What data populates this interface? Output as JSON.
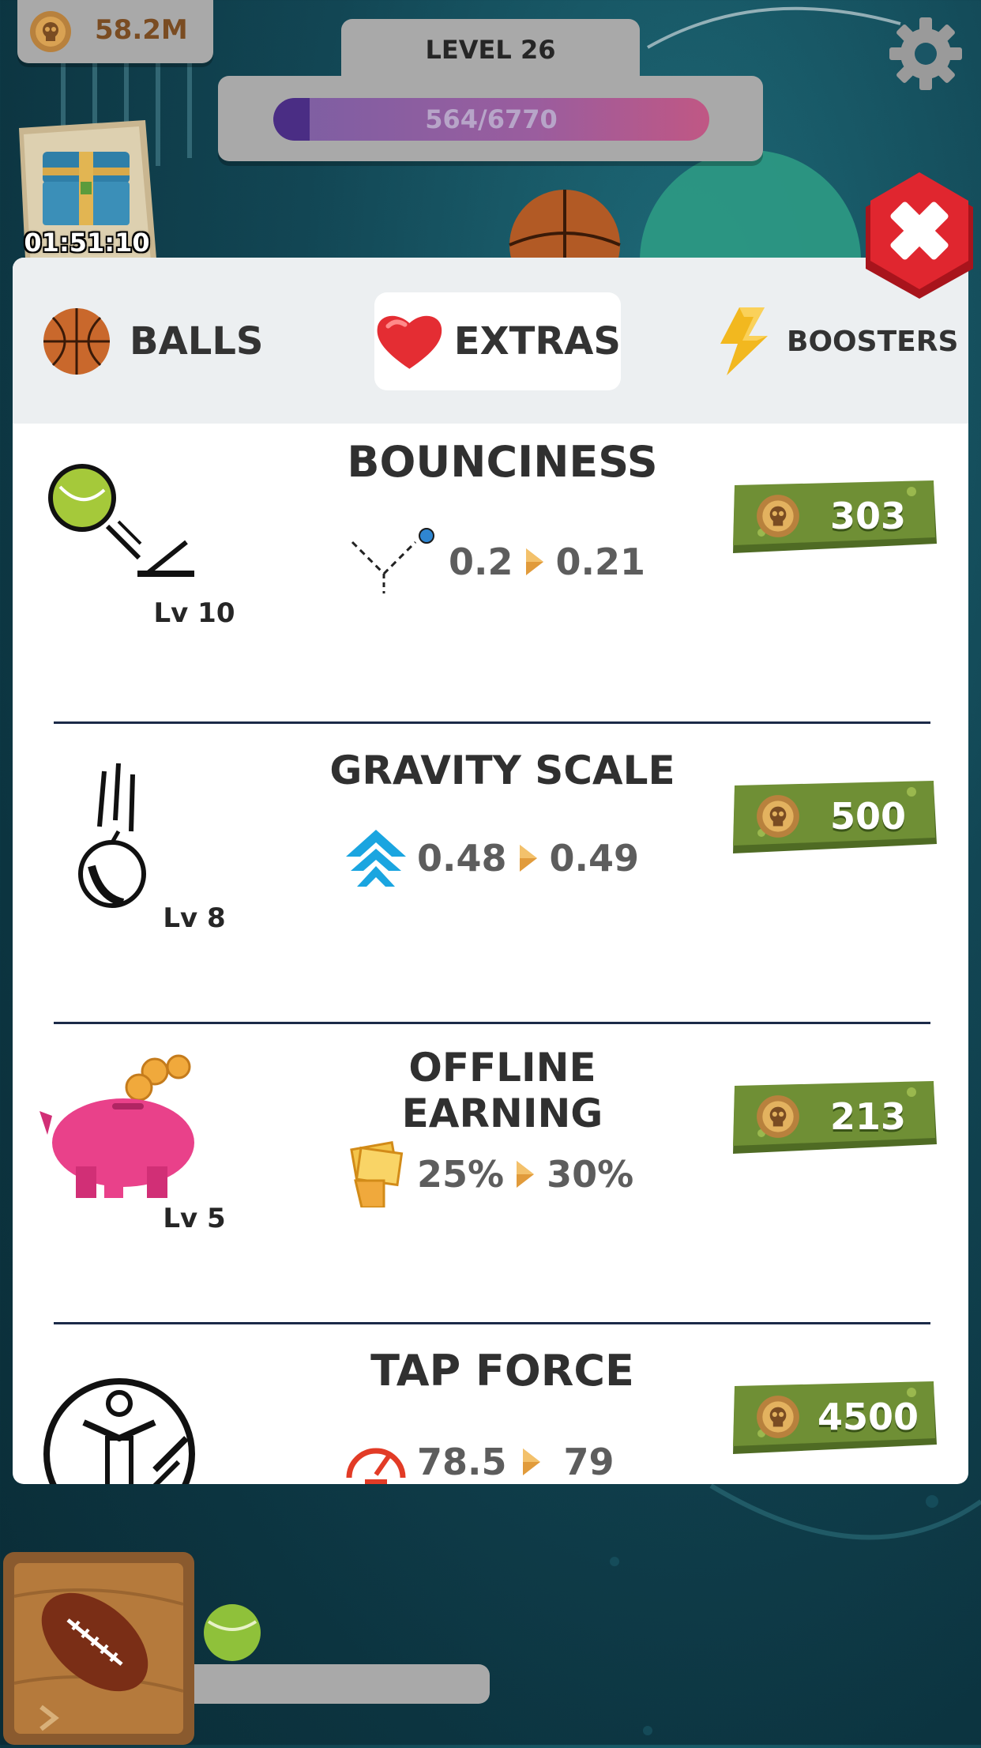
{
  "header": {
    "coins": "58.2M",
    "level_label": "LEVEL 26",
    "xp_text": "564/6770",
    "xp_fraction": 0.083,
    "chest_timer": "01:51:10"
  },
  "tabs": [
    {
      "label": "BALLS",
      "icon": "basketball-icon"
    },
    {
      "label": "EXTRAS",
      "icon": "heart-icon",
      "selected": true
    },
    {
      "label": "BOOSTERS",
      "icon": "lightning-icon"
    }
  ],
  "upgrades": [
    {
      "title": "BOUNCINESS",
      "level": "Lv 10",
      "current": "0.2",
      "next": "0.21",
      "price": "303"
    },
    {
      "title": "GRAVITY SCALE",
      "level": "Lv 8",
      "current": "0.48",
      "next": "0.49",
      "price": "500"
    },
    {
      "title": "OFFLINE EARNING",
      "level": "Lv 5",
      "current": "25%",
      "next": "30%",
      "price": "213"
    },
    {
      "title": "TAP FORCE",
      "level": "",
      "current": "78.5",
      "next": "79",
      "price": "4500"
    }
  ],
  "colors": {
    "accent_green": "#6f8f35",
    "close_red": "#e0262f",
    "xp_purple": "#4a2d84"
  }
}
